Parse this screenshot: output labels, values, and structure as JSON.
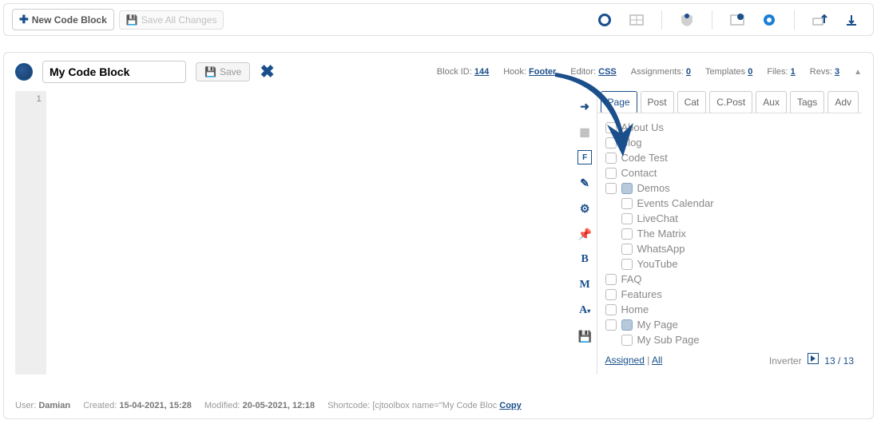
{
  "toolbar": {
    "new_label": "New Code Block",
    "save_all_label": "Save All Changes"
  },
  "block": {
    "title": "My Code Block",
    "save_label": "Save",
    "id_label": "Block ID:",
    "id": "144",
    "hook_label": "Hook:",
    "hook": "Footer",
    "editor_label": "Editor:",
    "editor": "CSS",
    "assign_label": "Assignments:",
    "assign": "0",
    "tpl_label": "Templates",
    "tpl": "0",
    "files_label": "Files:",
    "files": "1",
    "revs_label": "Revs:",
    "revs": "3"
  },
  "tabs": [
    "Page",
    "Post",
    "Cat",
    "C.Post",
    "Aux",
    "Tags",
    "Adv"
  ],
  "pages": [
    {
      "label": "About Us",
      "lvl": 0
    },
    {
      "label": "Blog",
      "lvl": 0
    },
    {
      "label": "Code Test",
      "lvl": 0
    },
    {
      "label": "Contact",
      "lvl": 0
    },
    {
      "label": "Demos",
      "lvl": 0,
      "expand": true
    },
    {
      "label": "Events Calendar",
      "lvl": 1
    },
    {
      "label": "LiveChat",
      "lvl": 1
    },
    {
      "label": "The Matrix",
      "lvl": 1
    },
    {
      "label": "WhatsApp",
      "lvl": 1
    },
    {
      "label": "YouTube",
      "lvl": 1
    },
    {
      "label": "FAQ",
      "lvl": 0
    },
    {
      "label": "Features",
      "lvl": 0
    },
    {
      "label": "Home",
      "lvl": 0
    },
    {
      "label": "My Page",
      "lvl": 0,
      "expand": true
    },
    {
      "label": "My Sub Page",
      "lvl": 1
    }
  ],
  "assign_footer": {
    "assigned": "Assigned",
    "all": "All",
    "separator": " | ",
    "inverter": "Inverter",
    "count": "13 / 13"
  },
  "footer": {
    "user_label": "User:",
    "user": "Damian",
    "created_label": "Created:",
    "created": "15-04-2021, 15:28",
    "modified_label": "Modified:",
    "modified": "20-05-2021, 12:18",
    "shortcode_label": "Shortcode:",
    "shortcode": "[cjtoolbox name=\"My Code Bloc",
    "copy": "Copy"
  },
  "gutter_line": "1"
}
